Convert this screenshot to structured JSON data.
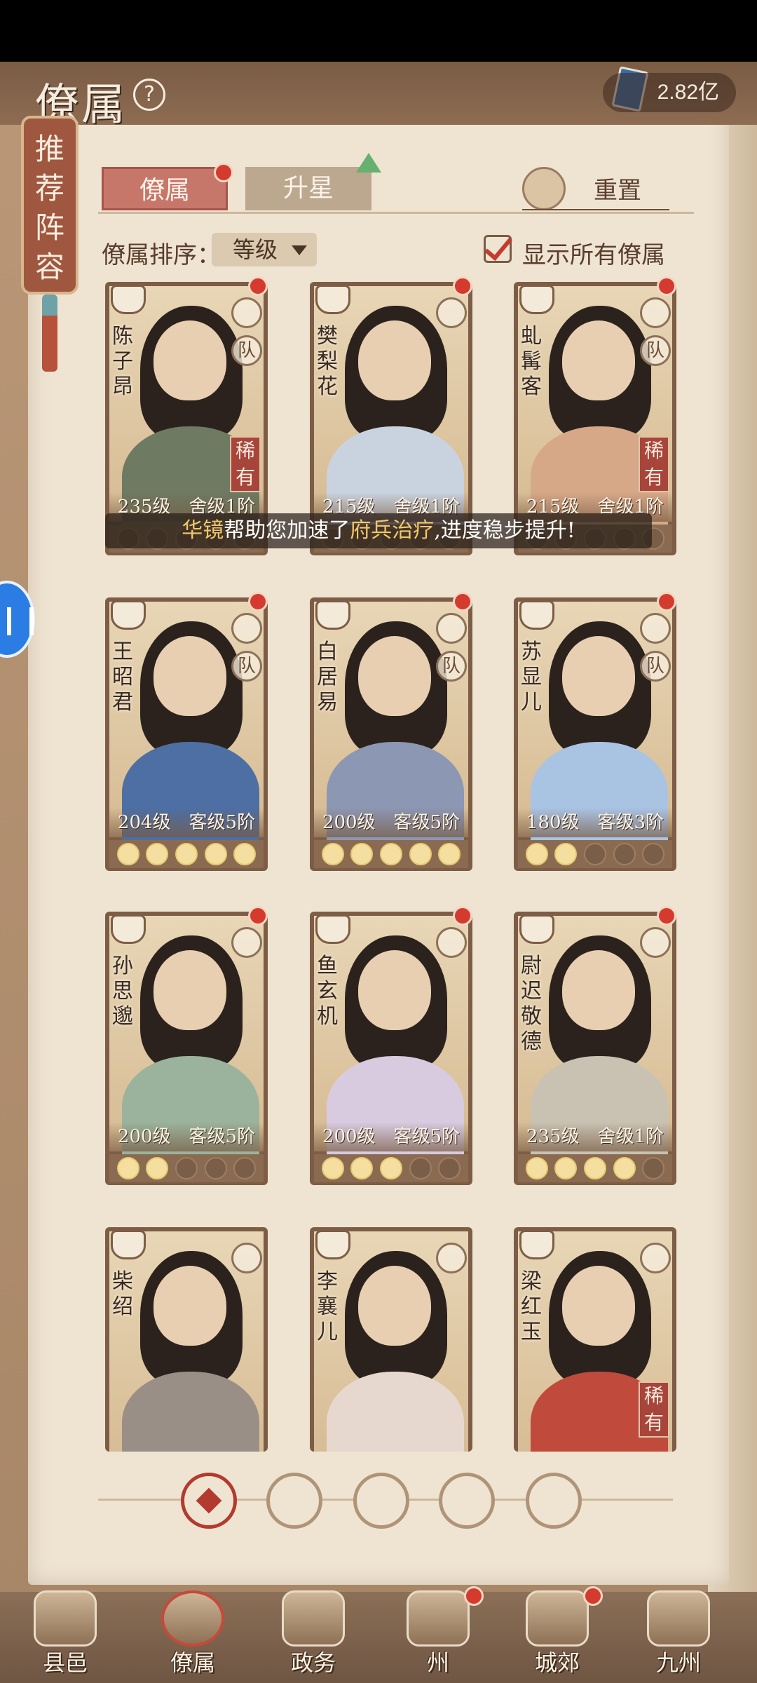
{
  "header": {
    "title": "僚属",
    "currency": "2.82亿"
  },
  "recommend": "推荐阵容",
  "tabs": {
    "retainer": "僚属",
    "star": "升星"
  },
  "reset": "重置",
  "sort": {
    "label": "僚属排序：",
    "value": "等级"
  },
  "show_all": "显示所有僚属",
  "toast": {
    "hl1": "华镜",
    "part1": "帮助您加速了",
    "hl2": "府兵治疗",
    "part2": ",进度稳步提升!"
  },
  "cards": [
    {
      "name": "陈子昂",
      "info": "235级　舍级1阶",
      "rare": "稀有",
      "team": "队",
      "moons": 5,
      "lit": 0,
      "colors": {
        "body": "#6e7a62"
      }
    },
    {
      "name": "樊梨花",
      "info": "215级　舍级1阶",
      "rare": "",
      "team": "",
      "moons": 5,
      "lit": 0,
      "colors": {
        "body": "#c9d3e0"
      }
    },
    {
      "name": "虬髯客",
      "info": "215级　舍级1阶",
      "rare": "稀有",
      "team": "队",
      "moons": 5,
      "lit": 0,
      "colors": {
        "body": "#d6a888"
      }
    },
    {
      "name": "王昭君",
      "info": "204级　客级5阶",
      "rare": "",
      "team": "队",
      "moons": 5,
      "lit": 5,
      "colors": {
        "body": "#4d6fa3"
      }
    },
    {
      "name": "白居易",
      "info": "200级　客级5阶",
      "rare": "",
      "team": "队",
      "moons": 5,
      "lit": 5,
      "colors": {
        "body": "#8c97b3"
      }
    },
    {
      "name": "苏显儿",
      "info": "180级　客级3阶",
      "rare": "",
      "team": "队",
      "moons": 5,
      "lit": 2,
      "colors": {
        "body": "#a9c3e3"
      }
    },
    {
      "name": "孙思邈",
      "info": "200级　客级5阶",
      "rare": "",
      "team": "",
      "moons": 5,
      "lit": 2,
      "colors": {
        "body": "#9bb39c"
      }
    },
    {
      "name": "鱼玄机",
      "info": "200级　客级5阶",
      "rare": "",
      "team": "",
      "moons": 5,
      "lit": 3,
      "colors": {
        "body": "#d8cbe0"
      }
    },
    {
      "name": "尉迟敬德",
      "info": "235级　舍级1阶",
      "rare": "",
      "team": "",
      "moons": 5,
      "lit": 4,
      "colors": {
        "body": "#c9c2b3"
      }
    },
    {
      "name": "柴绍",
      "info": "",
      "rare": "",
      "team": "",
      "moons": 0,
      "lit": 0,
      "colors": {
        "body": "#9a8f87"
      }
    },
    {
      "name": "李襄儿",
      "info": "",
      "rare": "",
      "team": "",
      "moons": 0,
      "lit": 0,
      "colors": {
        "body": "#e7d8cf"
      }
    },
    {
      "name": "梁红玉",
      "info": "",
      "rare": "稀有",
      "team": "",
      "moons": 0,
      "lit": 0,
      "colors": {
        "body": "#c04a3c"
      }
    }
  ],
  "nav": [
    {
      "label": "县邑"
    },
    {
      "label": "僚属"
    },
    {
      "label": "政务"
    },
    {
      "label": "州"
    },
    {
      "label": "城郊"
    },
    {
      "label": "九州"
    }
  ]
}
